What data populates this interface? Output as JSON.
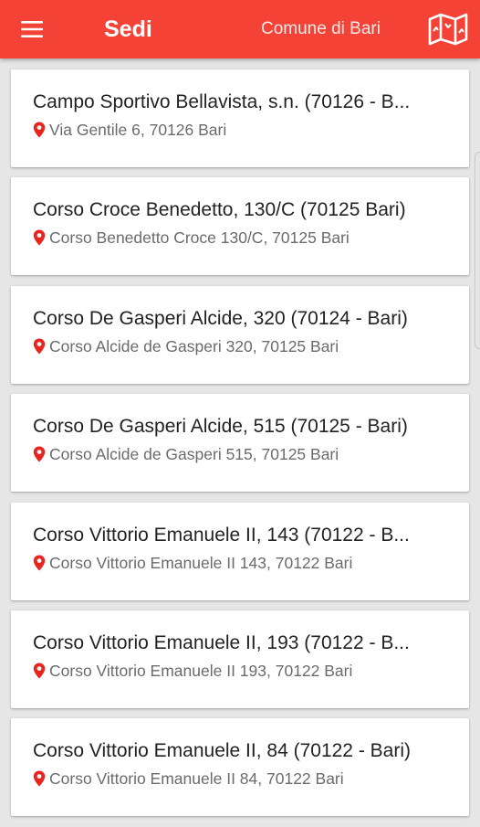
{
  "appbar": {
    "title": "Sedi",
    "subtitle": "Comune di Bari",
    "menu_icon": "hamburger-menu-icon",
    "map_icon": "folded-map-icon",
    "color": "#f44336"
  },
  "locations": [
    {
      "name": "Campo Sportivo Bellavista, s.n. (70126 - B...",
      "address": "Via Gentile 6, 70126 Bari"
    },
    {
      "name": "Corso Croce Benedetto, 130/C (70125 Bari)",
      "address": "Corso Benedetto Croce 130/C, 70125 Bari"
    },
    {
      "name": "Corso De Gasperi Alcide, 320 (70124 - Bari)",
      "address": "Corso Alcide de Gasperi 320, 70125 Bari"
    },
    {
      "name": "Corso De Gasperi Alcide, 515 (70125 - Bari)",
      "address": "Corso Alcide de Gasperi 515, 70125 Bari"
    },
    {
      "name": "Corso Vittorio Emanuele II, 143 (70122 - B...",
      "address": "Corso Vittorio Emanuele II 143, 70122 Bari"
    },
    {
      "name": "Corso Vittorio Emanuele II, 193 (70122 - B...",
      "address": "Corso Vittorio Emanuele II 193, 70122 Bari"
    },
    {
      "name": "Corso Vittorio Emanuele II, 84 (70122 - Bari)",
      "address": "Corso Vittorio Emanuele II 84, 70122 Bari"
    }
  ],
  "pin_icon": "map-pin-icon",
  "pin_color": "#e8261f"
}
